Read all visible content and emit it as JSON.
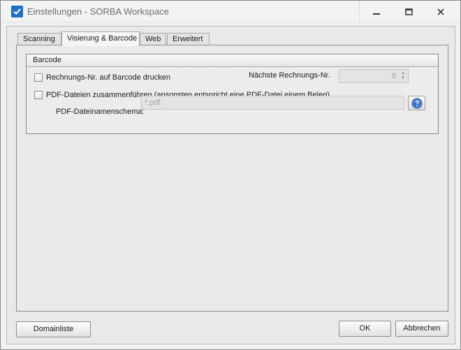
{
  "window": {
    "title": "Einstellungen - SORBA Workspace",
    "controls": {
      "minimize_glyph": "—",
      "maximize_glyph": "☐",
      "close_glyph": "✕"
    }
  },
  "tabs": [
    {
      "label": "Scanning",
      "active": false
    },
    {
      "label": "Visierung & Barcode",
      "active": true
    },
    {
      "label": "Web",
      "active": false
    },
    {
      "label": "Erweitert",
      "active": false
    }
  ],
  "barcode_group": {
    "title": "Barcode",
    "print_invoice_no": {
      "label": "Rechnungs-Nr. auf Barcode drucken",
      "checked": false
    },
    "next_invoice_no": {
      "label": "Nächste Rechnungs-Nr.",
      "value": "0"
    },
    "merge_pdf": {
      "label": "PDF-Dateien zusammenführen (ansonsten entspricht eine PDF-Datei einem Beleg)",
      "checked": false
    },
    "pdf_filename_schema": {
      "label": "PDF-Dateinamenschema:",
      "value": "*.pdf"
    },
    "help_icon": "question-mark-icon"
  },
  "footer": {
    "domain_list_label": "Domainliste",
    "ok_label": "OK",
    "cancel_label": "Abbrechen"
  },
  "colors": {
    "accent": "#1f6fc4",
    "help_icon": "#2e66c9"
  }
}
